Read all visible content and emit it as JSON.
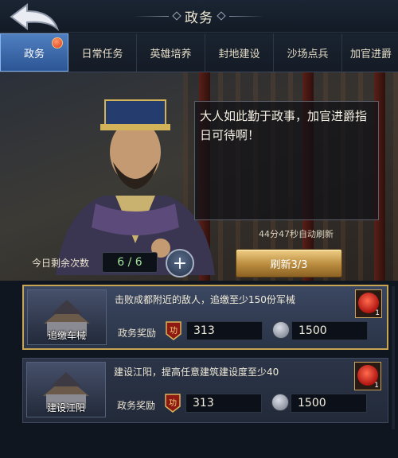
{
  "header": {
    "title": "政务",
    "back_icon": "back-arrow-icon"
  },
  "tabs": [
    {
      "label": "政务",
      "active": true,
      "has_badge": true
    },
    {
      "label": "日常任务"
    },
    {
      "label": "英雄培养"
    },
    {
      "label": "封地建设"
    },
    {
      "label": "沙场点兵"
    },
    {
      "label": "加官进爵"
    }
  ],
  "scene": {
    "dialogue": "大人如此勤于政事，加官进爵指日可待啊！",
    "refresh_timer": "44分47秒自动刷新",
    "refresh_button": "刷新3/3",
    "remaining_label": "今日剩余次数",
    "remaining_value": "6 / 6"
  },
  "tasks": [
    {
      "image_label": "追缴车械",
      "description": "击败成都附近的敌人，追缴至少150份军械",
      "reward_label": "政务奖励",
      "merit_icon_text": "功",
      "merit_value": "313",
      "coin_value": "1500",
      "seal_count": "1",
      "selected": true
    },
    {
      "image_label": "建设江阳",
      "description": "建设江阳，提高任意建筑建设度至少40",
      "reward_label": "政务奖励",
      "merit_icon_text": "功",
      "merit_value": "313",
      "coin_value": "1500",
      "seal_count": "1",
      "selected": false
    }
  ],
  "colors": {
    "accent_blue": "#2c5595",
    "gold": "#c7a553",
    "count_green": "#9fe39a"
  }
}
